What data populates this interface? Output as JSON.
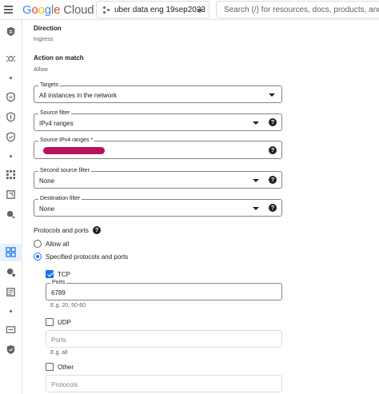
{
  "header": {
    "logo_text": "Google Cloud",
    "project_name": "uber data eng 19sep2023",
    "search_placeholder": "Search (/) for resources, docs, products, and m"
  },
  "rail": {
    "icons": [
      "vpc-network-icon",
      "ip-address-icon",
      "firewall-icon",
      "firewall-policy-icon",
      "shield-icon",
      "grid-icon",
      "routes-icon",
      "security-icon",
      "dashboard-icon",
      "network-icon",
      "list-icon",
      "folder-icon",
      "shield-check-icon"
    ]
  },
  "form": {
    "direction": {
      "label": "Direction",
      "value": "Ingress"
    },
    "action": {
      "label": "Action on match",
      "value": "Allow"
    },
    "targets": {
      "label": "Targets",
      "value": "All instances in the network"
    },
    "source_filter": {
      "label": "Source filter",
      "value": "IPv4 ranges"
    },
    "source_ranges": {
      "label": "Source IPv4 ranges *",
      "value": ""
    },
    "second_source_filter": {
      "label": "Second source filter",
      "value": "None"
    },
    "destination_filter": {
      "label": "Destination filter",
      "value": "None"
    },
    "protocols": {
      "title": "Protocols and ports",
      "allow_all": "Allow all",
      "specified": "Specified protocols and ports",
      "selected": "specified",
      "tcp": {
        "label": "TCP",
        "checked": true,
        "ports_label": "Ports",
        "ports_value": "6789",
        "hint": "E.g. 20, 50-60"
      },
      "udp": {
        "label": "UDP",
        "checked": false,
        "ports_placeholder": "Ports",
        "hint": "E.g. all"
      },
      "other": {
        "label": "Other",
        "checked": false,
        "protocols_placeholder": "Protocols"
      }
    }
  },
  "colors": {
    "accent": "#1a73e8",
    "redaction": "#b5135e"
  }
}
